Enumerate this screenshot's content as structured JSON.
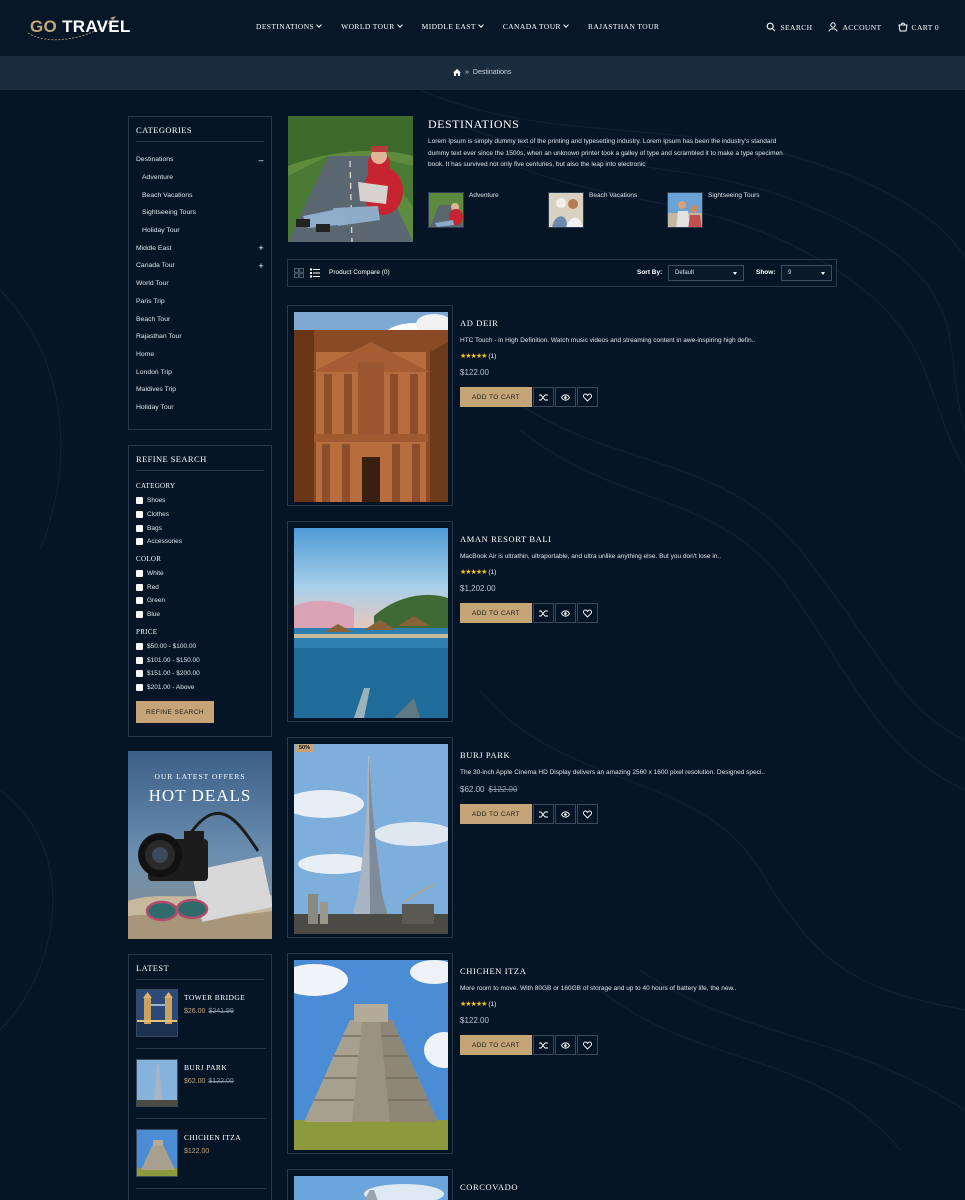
{
  "header": {
    "logo_go": "GO",
    "logo_rest": " TRAVEL",
    "nav": [
      {
        "label": "DESTINATIONS",
        "dropdown": true
      },
      {
        "label": "WORLD TOUR",
        "dropdown": true
      },
      {
        "label": "MIDDLE EAST",
        "dropdown": true
      },
      {
        "label": "CANADA TOUR",
        "dropdown": true
      },
      {
        "label": "RAJASTHAN TOUR",
        "dropdown": false
      }
    ],
    "search_label": "SEARCH",
    "account_label": "ACCOUNT",
    "cart_label": "CART 0"
  },
  "breadcrumb": {
    "separator": "»",
    "current": "Destinations"
  },
  "categories": {
    "title": "CATEGORIES",
    "items": [
      {
        "label": "Destinations",
        "toggle": "–",
        "sub": false
      },
      {
        "label": "Adventure",
        "toggle": "",
        "sub": true
      },
      {
        "label": "Beach Vacations",
        "toggle": "",
        "sub": true
      },
      {
        "label": "Sightseeing Tours",
        "toggle": "",
        "sub": true
      },
      {
        "label": "Holiday Tour",
        "toggle": "",
        "sub": true
      },
      {
        "label": "Middle East",
        "toggle": "+",
        "sub": false
      },
      {
        "label": "Canada Tour",
        "toggle": "+",
        "sub": false
      },
      {
        "label": "World Tour",
        "toggle": "",
        "sub": false
      },
      {
        "label": "Paris Trip",
        "toggle": "",
        "sub": false
      },
      {
        "label": "Beach Tour",
        "toggle": "",
        "sub": false
      },
      {
        "label": "Rajasthan Tour",
        "toggle": "",
        "sub": false
      },
      {
        "label": "Home",
        "toggle": "",
        "sub": false
      },
      {
        "label": "London Trip",
        "toggle": "",
        "sub": false
      },
      {
        "label": "Maldives Trip",
        "toggle": "",
        "sub": false
      },
      {
        "label": "Holiday Tour",
        "toggle": "",
        "sub": false
      }
    ]
  },
  "refine": {
    "title": "REFINE SEARCH",
    "groups": [
      {
        "label": "CATEGORY",
        "options": [
          "Shoes",
          "Clothes",
          "Bags",
          "Accessories"
        ]
      },
      {
        "label": "COLOR",
        "options": [
          "White",
          "Red",
          "Green",
          "Blue"
        ]
      },
      {
        "label": "PRICE",
        "options": [
          "$50.00 - $100.00",
          "$101.00 - $150.00",
          "$151.00 - $200.00",
          "$201.00 - Above"
        ]
      }
    ],
    "button": "REFINE SEARCH"
  },
  "deal": {
    "subtitle": "OUR LATEST OFFERS",
    "title": "HOT DEALS"
  },
  "latest": {
    "title": "LATEST",
    "items": [
      {
        "name": "TOWER BRIDGE",
        "price": "$26.00",
        "old": "$241.99"
      },
      {
        "name": "BURJ PARK",
        "price": "$62.00",
        "old": "$122.00"
      },
      {
        "name": "CHICHEN ITZA",
        "price": "$122.00",
        "old": ""
      }
    ]
  },
  "page": {
    "title": "DESTINATIONS",
    "description": "Lorem Ipsum is simply dummy text of the printing and typesetting industry. Lorem Ipsum has been the industry's standard dummy text ever since the 1500s, when an unknown printer took a galley of type and scrambled it to make a type specimen book. It has survived not only five centuries, but also the leap into electronic",
    "subcategories": [
      "Adventure",
      "Beach Vacations",
      "Sightseeing Tours"
    ]
  },
  "toolbar": {
    "compare": "Product Compare (0)",
    "sort_label": "Sort By:",
    "sort_value": "Default",
    "show_label": "Show:",
    "show_value": "9"
  },
  "products": [
    {
      "name": "AD DEIR",
      "desc": "HTC Touch - in High Definition. Watch music videos and streaming content in awe-inspiring high defin..",
      "rating": 5,
      "reviews": "(1)",
      "price": "$122.00",
      "old": "",
      "badge": ""
    },
    {
      "name": "AMAN RESORT BALI",
      "desc": "MacBook Air is ultrathin, ultraportable, and ultra unlike anything else. But you don't lose in..",
      "rating": 5,
      "reviews": "(1)",
      "price": "$1,202.00",
      "old": "",
      "badge": ""
    },
    {
      "name": "BURJ PARK",
      "desc": "The 30-inch Apple Cinema HD Display delivers an amazing 2560 x 1600 pixel resolution. Designed speci..",
      "rating": 0,
      "reviews": "",
      "price": "$62.00",
      "old": "$122.00",
      "badge": "50%"
    },
    {
      "name": "CHICHEN ITZA",
      "desc": "More room to move. With 80GB or 160GB of storage and up to 40 hours of battery life, the new..",
      "rating": 5,
      "reviews": "(1)",
      "price": "$122.00",
      "old": "",
      "badge": ""
    },
    {
      "name": "CORCOVADO",
      "desc": "",
      "rating": 0,
      "reviews": "",
      "price": "",
      "old": "",
      "badge": ""
    }
  ],
  "add_to_cart": "ADD TO CART",
  "colors": {
    "background": "#061526",
    "accent": "#c5a477",
    "border": "#27394b",
    "star": "#f3c21a"
  }
}
